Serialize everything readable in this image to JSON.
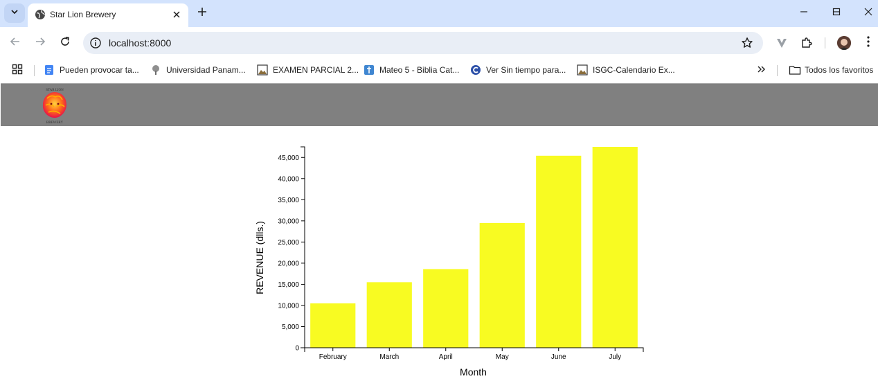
{
  "browser": {
    "tab_title": "Star Lion Brewery",
    "url": "localhost:8000",
    "bookmarks": [
      {
        "label": "Pueden provocar ta...",
        "icon": "docs-icon"
      },
      {
        "label": "Universidad Panam...",
        "icon": "tree-logo-icon"
      },
      {
        "label": "EXAMEN PARCIAL 2...",
        "icon": "image-icon"
      },
      {
        "label": "Mateo 5 - Biblia Cat...",
        "icon": "bible-icon"
      },
      {
        "label": "Ver Sin tiempo para...",
        "icon": "c-logo-icon"
      },
      {
        "label": "ISGC-Calendario Ex...",
        "icon": "image-icon"
      }
    ],
    "all_bookmarks_label": "Todos los favoritos",
    "colors": {
      "tabstrip": "#d3e3fd",
      "omnibox": "#e9eef6"
    }
  },
  "page": {
    "header_color": "#808080",
    "logo": {
      "top_text": "STAR LION",
      "bottom_text": "BREWERY"
    }
  },
  "chart_data": {
    "type": "bar",
    "categories": [
      "February",
      "March",
      "April",
      "May",
      "June",
      "July"
    ],
    "values": [
      10500,
      15500,
      18600,
      29500,
      45400,
      47500
    ],
    "xlabel": "Month",
    "ylabel": "REVENUE (dlls.)",
    "ylim": [
      0,
      47500
    ],
    "yticks": [
      0,
      5000,
      10000,
      15000,
      20000,
      25000,
      30000,
      35000,
      40000,
      45000
    ],
    "ytick_labels": [
      "0",
      "5,000",
      "10,000",
      "15,000",
      "20,000",
      "25,000",
      "30,000",
      "35,000",
      "40,000",
      "45,000"
    ],
    "bar_color": "#f8fb22",
    "grid": false
  }
}
